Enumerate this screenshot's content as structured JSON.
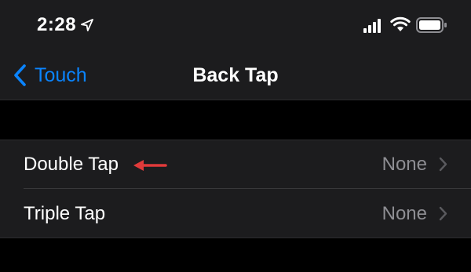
{
  "status_bar": {
    "time": "2:28",
    "location_icon": "location-arrow-icon",
    "signal_icon": "cellular-signal-icon",
    "wifi_icon": "wifi-icon",
    "battery_icon": "battery-icon"
  },
  "nav": {
    "back_label": "Touch",
    "back_icon": "chevron-left-icon",
    "title": "Back Tap"
  },
  "rows": [
    {
      "label": "Double Tap",
      "value": "None",
      "icon": "chevron-right-icon"
    },
    {
      "label": "Triple Tap",
      "value": "None",
      "icon": "chevron-right-icon"
    }
  ],
  "annotation": {
    "icon": "red-arrow-left-icon",
    "color": "#e03a3a"
  },
  "colors": {
    "background": "#000000",
    "surface": "#1c1c1e",
    "accent": "#0a84ff",
    "secondary_text": "#8e8e93"
  }
}
